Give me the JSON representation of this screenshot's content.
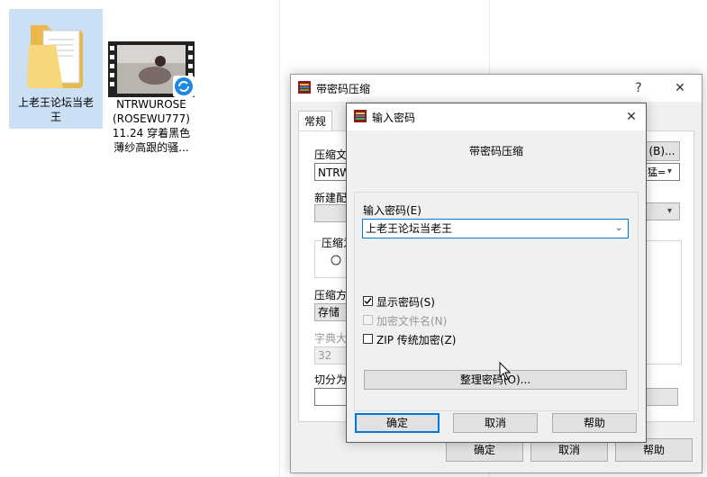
{
  "desktop": {
    "folder_label_line1": "上老王论坛当老",
    "folder_label_line2": "王",
    "video_label_line1": "NTRWUROSE",
    "video_label_line2": "(ROSEWU777)",
    "video_label_line3": "11.24 穿着黑色",
    "video_label_line4": "薄纱高跟的骚..."
  },
  "back_dialog": {
    "title": "带密码压缩",
    "help_glyph": "?",
    "close_glyph": "✕",
    "tab_general": "常规",
    "label_archive_name": "压缩文",
    "archive_name_value": "NTRWU",
    "browse_label": "(B)...",
    "combo_right_text": "猛=",
    "label_profile": "新建配",
    "label_update": "压缩为",
    "label_method": "压缩方",
    "method_value": "存储",
    "label_dict": "字典大",
    "dict_value": "32",
    "label_split": "切分为",
    "ok_label": "确定",
    "cancel_label": "取消",
    "help_label": "帮助"
  },
  "password_dialog": {
    "title": "输入密码",
    "close_glyph": "✕",
    "heading": "带密码压缩",
    "label_enter_password": "输入密码(E)",
    "password_value": "上老王论坛当老王",
    "show_password_label": "显示密码(S)",
    "show_password_checked": true,
    "encrypt_filenames_label": "加密文件名(N)",
    "encrypt_filenames_checked": false,
    "zip_legacy_label": "ZIP 传统加密(Z)",
    "zip_legacy_checked": false,
    "organize_label": "整理密码(O)...",
    "ok_label": "确定",
    "cancel_label": "取消",
    "help_label": "帮助"
  },
  "colors": {
    "accent": "#0078d7",
    "selection": "#cce0f5",
    "folder": "#f7d77a"
  }
}
